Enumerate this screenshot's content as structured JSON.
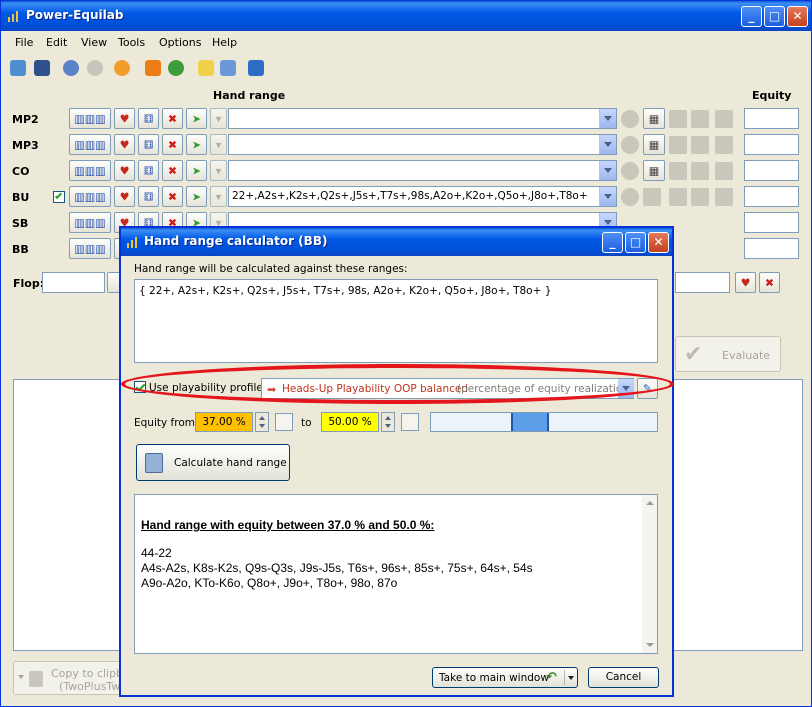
{
  "app": {
    "title": "Power-Equilab"
  },
  "menu": [
    "File",
    "Edit",
    "View",
    "Tools",
    "Options",
    "Help"
  ],
  "toolbar_icons": [
    "open-icon",
    "save-icon",
    "undo-icon",
    "redo-icon",
    "settings-icon",
    "fire-icon",
    "refresh-icon",
    "pencil-icon",
    "edit-pencil-icon",
    "book-icon"
  ],
  "headers": {
    "hand_range": "Hand range",
    "equity": "Equity"
  },
  "players": [
    {
      "name": "MP2",
      "range": "",
      "checked": false
    },
    {
      "name": "MP3",
      "range": "",
      "checked": false
    },
    {
      "name": "CO",
      "range": "",
      "checked": false
    },
    {
      "name": "BU",
      "range": "22+,A2s+,K2s+,Q2s+,J5s+,T7s+,98s,A2o+,K2o+,Q5o+,J8o+,T8o+",
      "checked": true
    },
    {
      "name": "SB",
      "range": "",
      "checked": false
    },
    {
      "name": "BB",
      "range": "",
      "checked": false
    }
  ],
  "flop": {
    "label": "Flop:",
    "value": ""
  },
  "evaluate": {
    "label": "Evaluate"
  },
  "copy": {
    "line1": "Copy to clipbo",
    "line2": "(TwoPlusTwo"
  },
  "dialog": {
    "title": "Hand range calculator (BB)",
    "intro": "Hand range will be calculated against these ranges:",
    "ranges_text": "{ 22+, A2s+, K2s+, Q2s+, J5s+, T7s+, 98s, A2o+, K2o+, Q5o+, J8o+, T8o+ }",
    "use_profile_label": "Use playability profile:",
    "profile_name": "Heads-Up Playability OOP balanced",
    "profile_desc": "(percentage of equity realization",
    "equity_from_label": "Equity from",
    "equity_from": "37.00 %",
    "to_label": "to",
    "equity_to": "50.00 %",
    "calc_button": "Calculate hand range",
    "result_title": "Hand range with equity between 37.0 % and 50.0 %:",
    "result_lines": [
      "44-22",
      "A4s-A2s, K8s-K2s, Q9s-Q3s, J9s-J5s, T6s+, 96s+, 85s+, 75s+, 64s+, 54s",
      "A9o-A2o, KTo-K6o, Q8o+, J9o+, T8o+, 98o, 87o"
    ],
    "take_button": "Take to main window",
    "cancel_button": "Cancel",
    "colors": {
      "from_bg": "#ffc000",
      "to_bg": "#ffff00",
      "highlight_ring": "#e4151b"
    }
  }
}
